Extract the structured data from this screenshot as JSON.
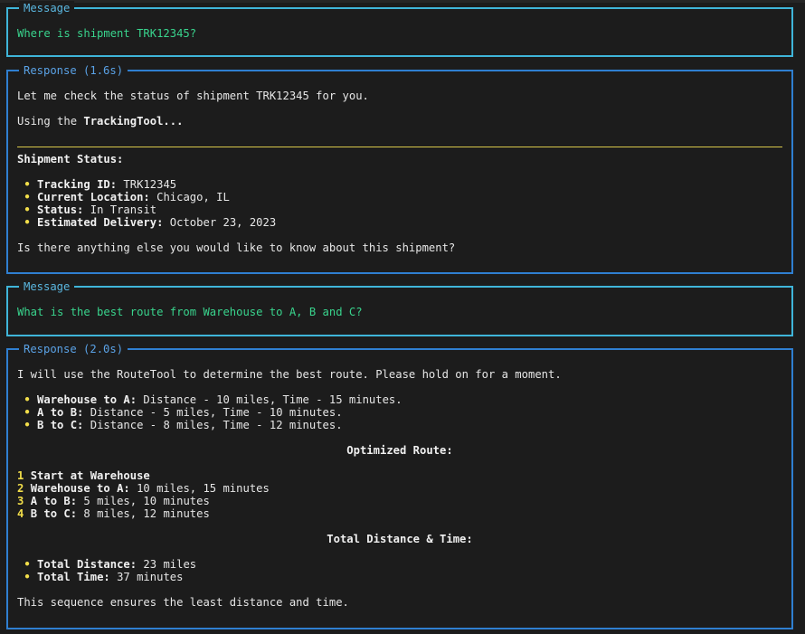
{
  "panels": [
    {
      "title": "Message",
      "text": "Where is shipment TRK12345?"
    },
    {
      "title": "Response (1.6s)",
      "intro": "Let me check the status of shipment TRK12345 for you.",
      "using_prefix": "Using the ",
      "using_tool": "TrackingTool...",
      "heading": "Shipment Status:",
      "bullets": [
        {
          "label": "Tracking ID:",
          "value": " TRK12345"
        },
        {
          "label": "Current Location:",
          "value": " Chicago, IL"
        },
        {
          "label": "Status:",
          "value": " In Transit"
        },
        {
          "label": "Estimated Delivery:",
          "value": " October 23, 2023"
        }
      ],
      "outro": "Is there anything else you would like to know about this shipment?"
    },
    {
      "title": "Message",
      "text": "What is the best route from Warehouse to A, B and C?"
    },
    {
      "title": "Response (2.0s)",
      "intro": "I will use the RouteTool to determine the best route. Please hold on for a moment.",
      "legs": [
        {
          "label": "Warehouse to A:",
          "value": " Distance - 10 miles, Time - 15 minutes."
        },
        {
          "label": "A to B:",
          "value": " Distance - 5 miles, Time - 10 minutes."
        },
        {
          "label": "B to C:",
          "value": " Distance - 8 miles, Time - 12 minutes."
        }
      ],
      "optimized_heading": "Optimized Route:",
      "steps": [
        {
          "num": "1",
          "label": "Start at Warehouse",
          "value": ""
        },
        {
          "num": "2",
          "label": "Warehouse to A:",
          "value": " 10 miles, 15 minutes"
        },
        {
          "num": "3",
          "label": "A to B:",
          "value": " 5 miles, 10 minutes"
        },
        {
          "num": "4",
          "label": "B to C:",
          "value": " 8 miles, 12 minutes"
        }
      ],
      "total_heading": "Total Distance & Time:",
      "totals": [
        {
          "label": "Total Distance:",
          "value": " 23 miles"
        },
        {
          "label": "Total Time:",
          "value": " 37 minutes"
        }
      ],
      "outro": "This sequence ensures the least distance and time."
    }
  ],
  "bullet_glyph": "•",
  "colors": {
    "background": "#1c1c1c",
    "message_border": "#3fb5d9",
    "response_border": "#2f7fd1",
    "user_text": "#39d48d",
    "bullet": "#f2de4a"
  }
}
